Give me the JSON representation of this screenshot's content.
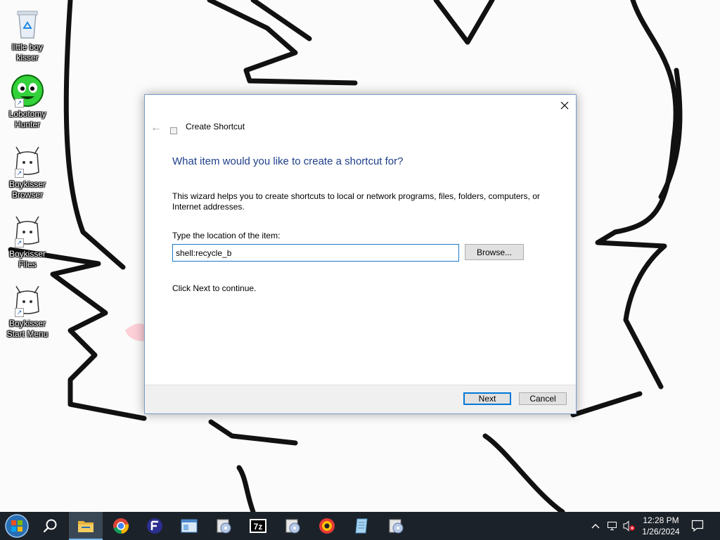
{
  "desktop": {
    "icons": [
      {
        "label": "little boy kisser",
        "icon": "recycle-bin-icon"
      },
      {
        "label": "Lobotomy Hunter",
        "icon": "green-face-icon"
      },
      {
        "label": "Boykisser Browser",
        "icon": "boykisser-icon"
      },
      {
        "label": "Boykisser Files",
        "icon": "boykisser-icon"
      },
      {
        "label": "Boykisser Start Menu",
        "icon": "boykisser-icon"
      }
    ]
  },
  "dialog": {
    "title": "Create Shortcut",
    "heading": "What item would you like to create a shortcut for?",
    "intro": "This wizard helps you to create shortcuts to local or network programs, files, folders, computers, or Internet addresses.",
    "location_label": "Type the location of the item:",
    "location_value": "shell:recycle_b",
    "browse_label": "Browse...",
    "continue_text": "Click Next to continue.",
    "next_label": "Next",
    "cancel_label": "Cancel"
  },
  "taskbar": {
    "apps": [
      "start-orb-icon",
      "search-icon",
      "file-explorer-icon",
      "chrome-icon",
      "app-f-icon",
      "window-icon",
      "cd-icon",
      "7zip-icon",
      "cd-icon",
      "browser-orb-icon",
      "notepad-icon",
      "cd-icon"
    ],
    "zip_label": "7z",
    "time": "12:28 PM",
    "date": "1/26/2024"
  },
  "colors": {
    "taskbar": "#1c2229",
    "heading": "#1e3f8b",
    "accent": "#0078d7"
  }
}
